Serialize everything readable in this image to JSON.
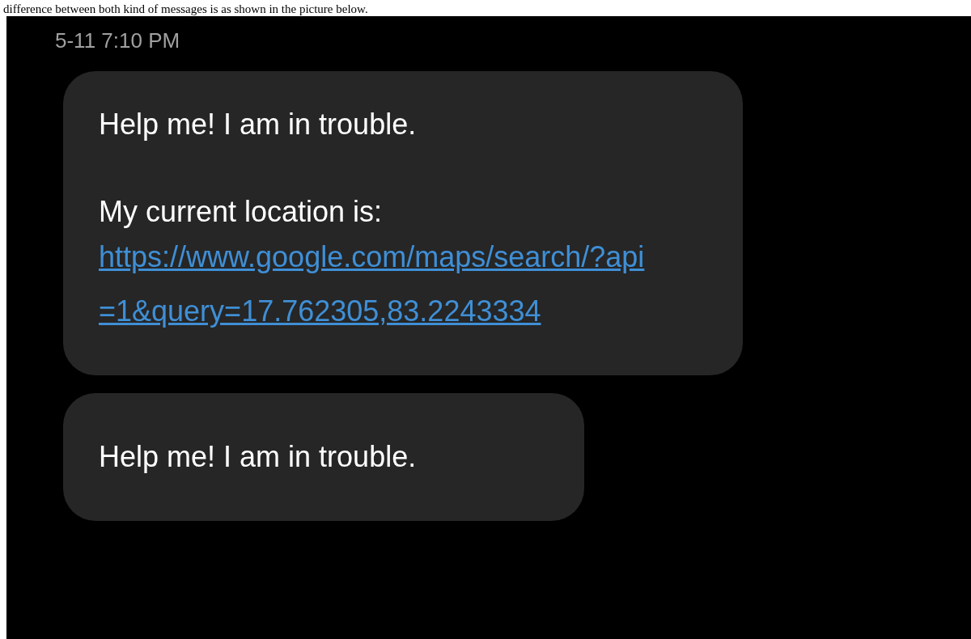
{
  "caption": "difference between both kind of messages is as shown in the picture below.",
  "timestamp": "5-11 7:10 PM",
  "messages": [
    {
      "kind": "location",
      "text": "Help me! I am in trouble.",
      "location_label": "My current location is:",
      "link": "https://www.google.com/maps/search/?api=1&query=17.762305,83.2243334"
    },
    {
      "kind": "plain",
      "text": "Help me! I am in trouble."
    }
  ]
}
